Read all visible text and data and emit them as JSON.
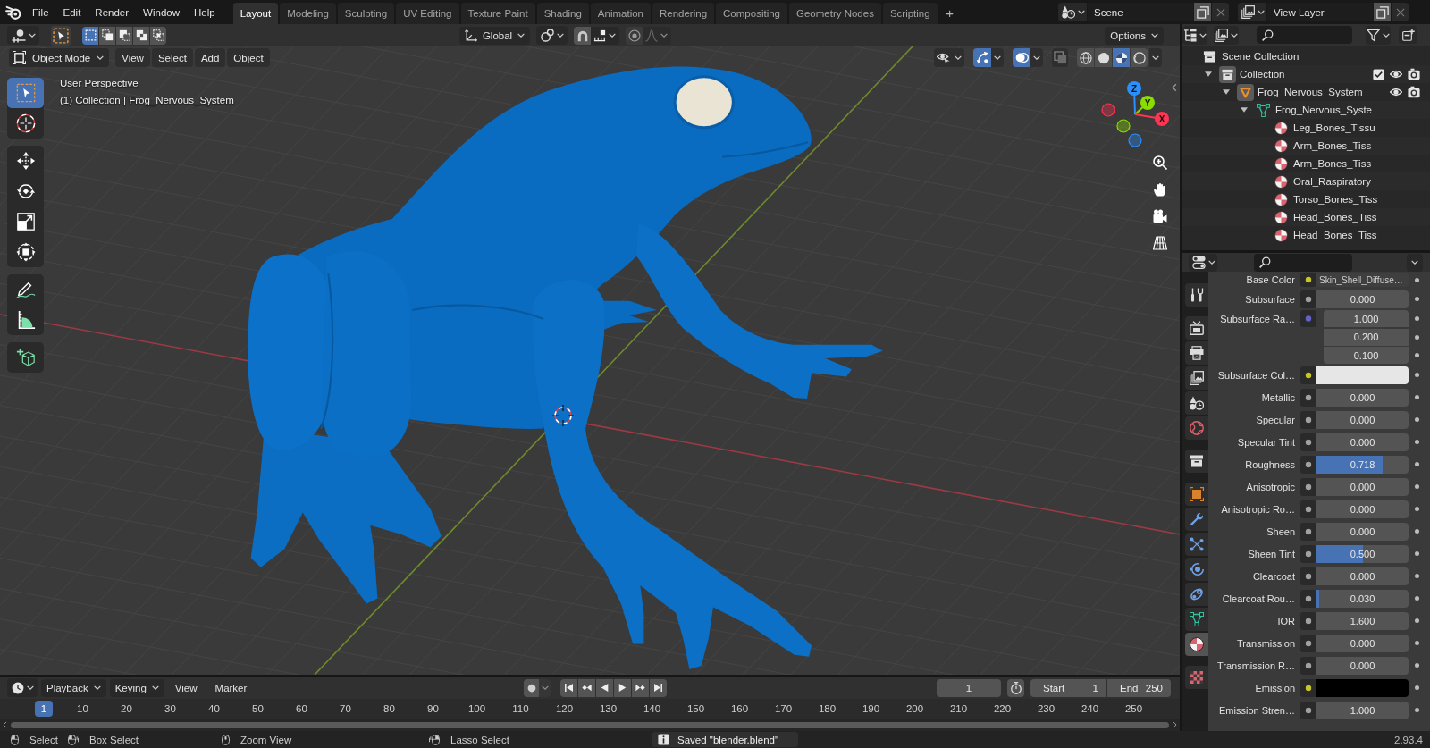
{
  "top_bar": {
    "menus": [
      "File",
      "Edit",
      "Render",
      "Window",
      "Help"
    ],
    "workspace_tabs": [
      {
        "label": "Layout",
        "selected": true
      },
      {
        "label": "Modeling",
        "selected": false
      },
      {
        "label": "Sculpting",
        "selected": false
      },
      {
        "label": "UV Editing",
        "selected": false
      },
      {
        "label": "Texture Paint",
        "selected": false
      },
      {
        "label": "Shading",
        "selected": false
      },
      {
        "label": "Animation",
        "selected": false
      },
      {
        "label": "Rendering",
        "selected": false
      },
      {
        "label": "Compositing",
        "selected": false
      },
      {
        "label": "Geometry Nodes",
        "selected": false
      },
      {
        "label": "Scripting",
        "selected": false
      }
    ],
    "add_tab": "+",
    "scene": "Scene",
    "view_layer": "View Layer"
  },
  "tool_header": {
    "select_modes": [
      {
        "kind": "set",
        "selected": true
      },
      {
        "kind": "extend",
        "selected": false
      },
      {
        "kind": "subtract",
        "selected": false
      },
      {
        "kind": "difference",
        "selected": false
      },
      {
        "kind": "intersect",
        "selected": false
      }
    ],
    "orientation": "Global",
    "options": "Options"
  },
  "viewport": {
    "mode": "Object Mode",
    "menus": [
      "View",
      "Select",
      "Add",
      "Object"
    ],
    "view_toggles": [
      {
        "kind": "visibility",
        "on": false,
        "dropdown": true
      },
      {
        "kind": "gizmos",
        "on": true,
        "dropdown": true
      },
      {
        "kind": "overlays",
        "on": true,
        "dropdown": true
      },
      {
        "kind": "xray",
        "on": false,
        "dropdown": false
      }
    ],
    "shading_modes": [
      {
        "kind": "wireframe",
        "selected": false
      },
      {
        "kind": "solid",
        "selected": false
      },
      {
        "kind": "material",
        "selected": true
      },
      {
        "kind": "rendered",
        "selected": false
      }
    ],
    "view_name": "User Perspective",
    "context": "(1) Collection | Frog_Nervous_System",
    "toolbar": {
      "groups": [
        {
          "tools": [
            {
              "kind": "select_box",
              "selected": true
            },
            {
              "kind": "cursor",
              "selected": false
            }
          ]
        },
        {
          "tools": [
            {
              "kind": "move",
              "selected": false
            },
            {
              "kind": "rotate",
              "selected": false
            },
            {
              "kind": "scale",
              "selected": false
            },
            {
              "kind": "transform",
              "selected": false
            }
          ]
        },
        {
          "tools": [
            {
              "kind": "annotate",
              "selected": false
            },
            {
              "kind": "measure",
              "selected": false
            }
          ]
        },
        {
          "tools": [
            {
              "kind": "add_cube",
              "selected": false
            }
          ]
        }
      ]
    },
    "axes": [
      {
        "label": "Z",
        "color": "#2890ff"
      },
      {
        "label": "Y",
        "color": "#8bdc00"
      },
      {
        "label": "X",
        "color": "#ff3352"
      }
    ]
  },
  "timeline": {
    "menus": [
      {
        "label": "Playback",
        "dropdown": true
      },
      {
        "label": "Keying",
        "dropdown": true
      },
      {
        "label": "View",
        "dropdown": false
      },
      {
        "label": "Marker",
        "dropdown": false
      }
    ],
    "transport": [
      {
        "kind": "jump_start"
      },
      {
        "kind": "prev_key"
      },
      {
        "kind": "play_reverse"
      },
      {
        "kind": "play"
      },
      {
        "kind": "next_key"
      },
      {
        "kind": "jump_end"
      }
    ],
    "current_frame": "1",
    "start_label": "Start",
    "start": "1",
    "end_label": "End",
    "end": "250",
    "playhead": "1",
    "frame_labels": [
      "10",
      "20",
      "30",
      "40",
      "50",
      "60",
      "70",
      "80",
      "90",
      "100",
      "110",
      "120",
      "130",
      "140",
      "150",
      "160",
      "170",
      "180",
      "190",
      "200",
      "210",
      "220",
      "230",
      "240",
      "250"
    ]
  },
  "outliner": {
    "tree": [
      {
        "label": "Scene Collection",
        "kind": "scene_collection",
        "active": false,
        "children": [
          {
            "label": "Collection",
            "kind": "collection",
            "active": true,
            "expanded": true,
            "checked": true,
            "visible": true,
            "renderable": true,
            "children": [
              {
                "label": "Frog_Nervous_System",
                "kind": "object",
                "active": true,
                "expanded": true,
                "visible": true,
                "renderable": true,
                "children": [
                  {
                    "label": "Frog_Nervous_Syste",
                    "kind": "mesh",
                    "active": false,
                    "expanded": true,
                    "children": [
                      {
                        "label": "Leg_Bones_Tissu",
                        "kind": "material",
                        "active": false
                      },
                      {
                        "label": "Arm_Bones_Tiss",
                        "kind": "material",
                        "active": false
                      },
                      {
                        "label": "Arm_Bones_Tiss",
                        "kind": "material",
                        "active": false
                      },
                      {
                        "label": "Oral_Raspiratory",
                        "kind": "material",
                        "active": false
                      },
                      {
                        "label": "Torso_Bones_Tiss",
                        "kind": "material",
                        "active": false
                      },
                      {
                        "label": "Head_Bones_Tiss",
                        "kind": "material",
                        "active": false
                      },
                      {
                        "label": "Head_Bones_Tiss",
                        "kind": "material",
                        "active": false
                      }
                    ]
                  }
                ]
              }
            ]
          }
        ]
      }
    ]
  },
  "properties": {
    "tab_groups": [
      {
        "tabs": [
          {
            "kind": "tool",
            "selected": false
          }
        ]
      },
      {
        "tabs": [
          {
            "kind": "render",
            "selected": false
          },
          {
            "kind": "output",
            "selected": false
          },
          {
            "kind": "view_layer",
            "selected": false
          },
          {
            "kind": "scene",
            "selected": false
          },
          {
            "kind": "world",
            "selected": false
          }
        ]
      },
      {
        "tabs": [
          {
            "kind": "collection",
            "selected": false
          }
        ]
      },
      {
        "tabs": [
          {
            "kind": "object",
            "selected": false
          },
          {
            "kind": "modifiers",
            "selected": false
          },
          {
            "kind": "particles",
            "selected": false
          },
          {
            "kind": "physics",
            "selected": false
          },
          {
            "kind": "constraints",
            "selected": false
          },
          {
            "kind": "data",
            "selected": false
          },
          {
            "kind": "material",
            "selected": true
          }
        ]
      },
      {
        "tabs": [
          {
            "kind": "texture",
            "selected": false
          }
        ]
      }
    ],
    "rows": [
      {
        "label": "Base Color",
        "kind": "link",
        "value": "Skin_Shell_Diffuse…"
      },
      {
        "label": "Subsurface",
        "kind": "number",
        "value": "0.000"
      },
      {
        "label": "Subsurface Ra…",
        "kind": "vector",
        "values": [
          "1.000",
          "0.200",
          "0.100"
        ]
      },
      {
        "label": "Subsurface Col…",
        "kind": "color",
        "color": "#e6e6e6"
      },
      {
        "label": "Metallic",
        "kind": "number",
        "value": "0.000"
      },
      {
        "label": "Specular",
        "kind": "number",
        "value": "0.000"
      },
      {
        "label": "Specular Tint",
        "kind": "number",
        "value": "0.000"
      },
      {
        "label": "Roughness",
        "kind": "slider",
        "value": "0.718",
        "level": 0.718
      },
      {
        "label": "Anisotropic",
        "kind": "number",
        "value": "0.000"
      },
      {
        "label": "Anisotropic Ro…",
        "kind": "number",
        "value": "0.000"
      },
      {
        "label": "Sheen",
        "kind": "number",
        "value": "0.000"
      },
      {
        "label": "Sheen Tint",
        "kind": "slider",
        "value": "0.500",
        "level": 0.5
      },
      {
        "label": "Clearcoat",
        "kind": "number",
        "value": "0.000"
      },
      {
        "label": "Clearcoat Rou…",
        "kind": "slider",
        "value": "0.030",
        "level": 0.03
      },
      {
        "label": "IOR",
        "kind": "number",
        "value": "1.600"
      },
      {
        "label": "Transmission",
        "kind": "number",
        "value": "0.000"
      },
      {
        "label": "Transmission R…",
        "kind": "number",
        "value": "0.000"
      },
      {
        "label": "Emission",
        "kind": "color",
        "color": "#000000"
      },
      {
        "label": "Emission Stren…",
        "kind": "number",
        "value": "1.000"
      }
    ]
  },
  "status_bar": {
    "hints": [
      {
        "kind": "left_click",
        "label": "Select"
      },
      {
        "kind": "left_drag",
        "label": "Box Select"
      },
      {
        "kind": "middle_drag",
        "label": "Zoom View"
      },
      {
        "kind": "right_drag",
        "label": "Lasso Select"
      }
    ],
    "message": "Saved \"blender.blend\"",
    "version": "2.93.4"
  }
}
